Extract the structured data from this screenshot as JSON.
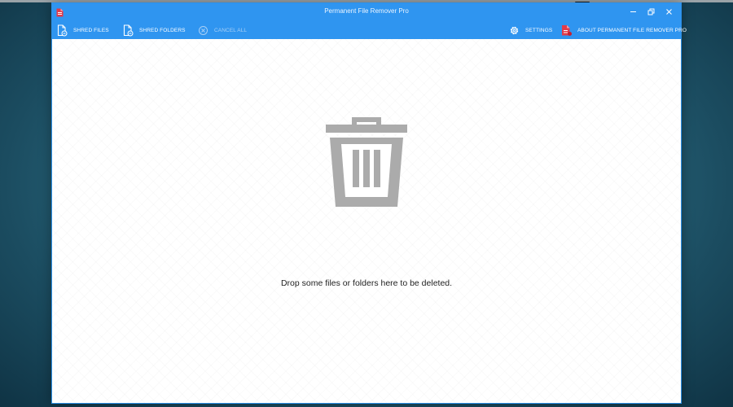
{
  "window": {
    "title": "Permanent File Remover Pro"
  },
  "toolbar": {
    "shred_files": "SHRED FILES",
    "shred_folders": "SHRED FOLDERS",
    "cancel_all": "CANCEL ALL",
    "settings": "SETTINGS",
    "about": "ABOUT PERMANENT FILE REMOVER PRO"
  },
  "main": {
    "drop_message": "Drop some files or folders here to be deleted."
  },
  "icons": {
    "app": "app-logo-icon",
    "shred_files": "file-shred-icon",
    "shred_folders": "folder-shred-icon",
    "cancel_all": "cancel-circle-icon",
    "settings": "gear-icon",
    "about": "about-logo-icon",
    "trash": "trash-can-icon"
  },
  "colors": {
    "titlebar": "#2f95f0",
    "accent_red": "#e23b4a",
    "trash_gray": "#ababab"
  }
}
